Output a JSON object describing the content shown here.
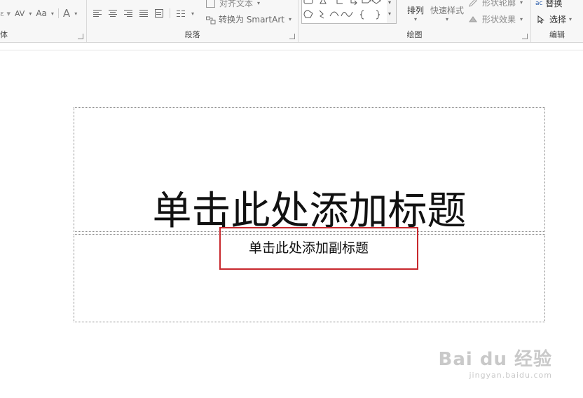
{
  "ribbon": {
    "font_group": {
      "label": "体",
      "char_spacing": "AV",
      "change_case": "Aa",
      "font_color": "A"
    },
    "paragraph_group": {
      "label": "段落",
      "align_text": "对齐文本",
      "convert_smartart": "转换为 SmartArt"
    },
    "drawing_group": {
      "label": "绘图",
      "arrange": "排列",
      "quick_styles": "快速样式",
      "shape_outline": "形状轮廓",
      "shape_effects": "形状效果"
    },
    "editing_group": {
      "label": "编辑",
      "replace": "替换",
      "select": "选择"
    }
  },
  "slide": {
    "title_placeholder": "单击此处添加标题",
    "subtitle_placeholder": "单击此处添加副标题"
  },
  "watermark": {
    "main": "Bai du 经验",
    "sub": "jingyan.baidu.com"
  },
  "colors": {
    "highlight": "#c8282d",
    "ribbon_bg": "#f7f7f7"
  }
}
